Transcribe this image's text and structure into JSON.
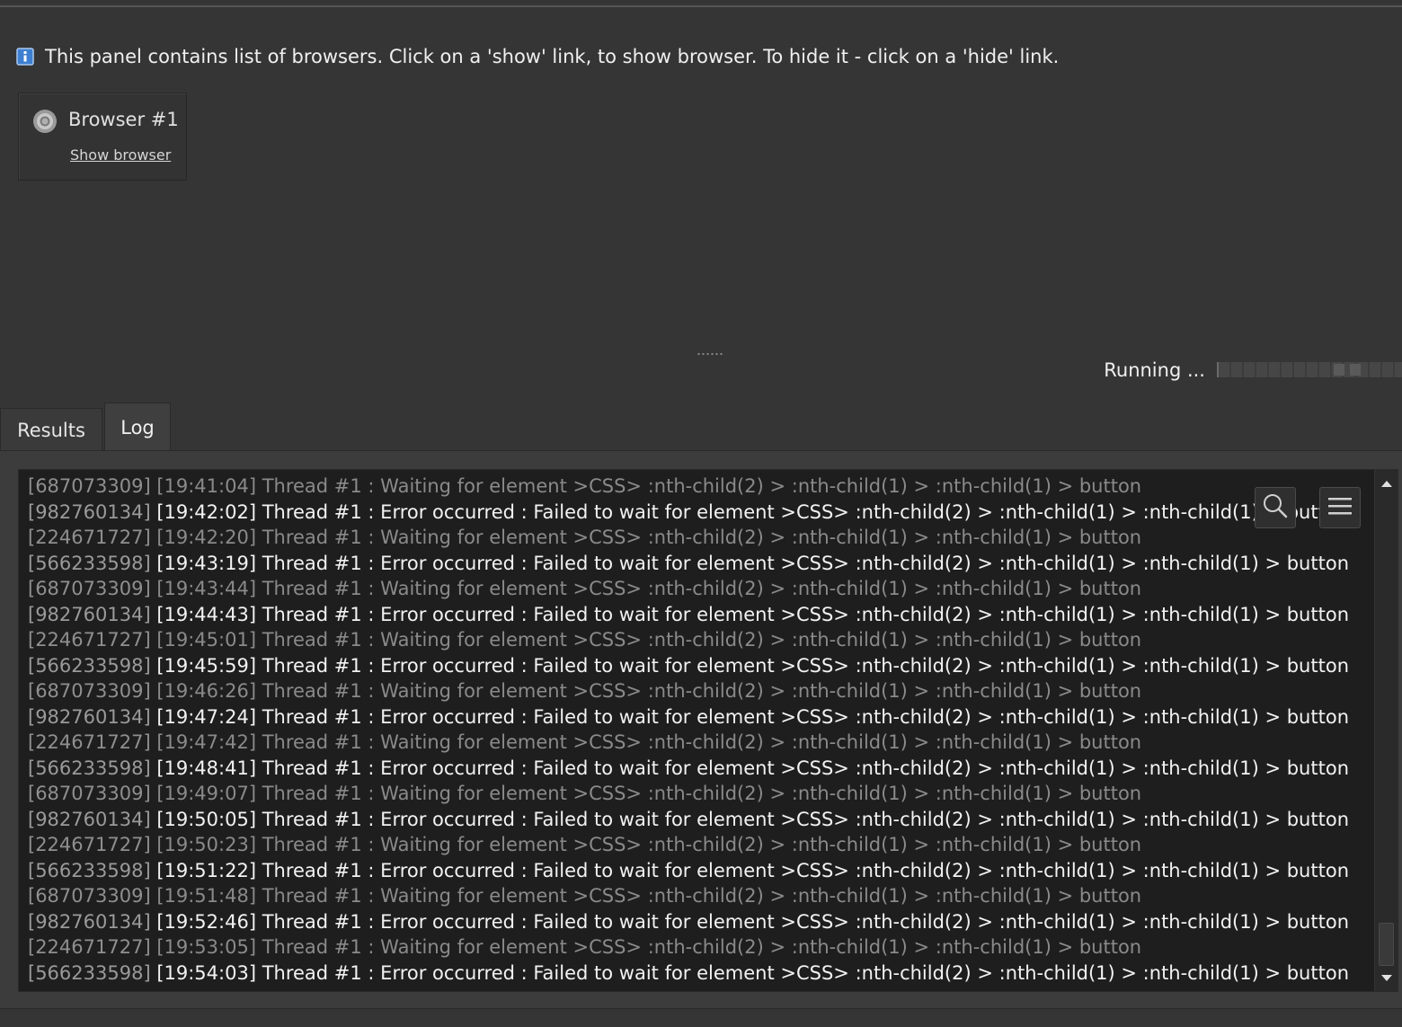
{
  "info": {
    "message": "This panel contains list of browsers. Click on a 'show' link, to show browser. To hide it - click on a 'hide' link.",
    "icon": "info-icon"
  },
  "browser_card": {
    "title": "Browser #1",
    "link": "Show browser",
    "icon": "browser-icon"
  },
  "status": {
    "text": "Running ..."
  },
  "tabs": [
    {
      "label": "Results",
      "active": false
    },
    {
      "label": "Log",
      "active": true
    }
  ],
  "log": {
    "lines": [
      {
        "id": "[687073309]",
        "text": " [19:41:04] Thread #1 : Waiting for element >CSS> :nth-child(2) > :nth-child(1) > :nth-child(1) > button",
        "kind": "waiting"
      },
      {
        "id": "[982760134]",
        "text": " [19:42:02] Thread #1 : Error occurred : Failed to wait for element >CSS> :nth-child(2) > :nth-child(1) > :nth-child(1) > button",
        "kind": "error"
      },
      {
        "id": "[224671727]",
        "text": " [19:42:20] Thread #1 : Waiting for element >CSS> :nth-child(2) > :nth-child(1) > :nth-child(1) > button",
        "kind": "waiting"
      },
      {
        "id": "[566233598]",
        "text": " [19:43:19] Thread #1 : Error occurred : Failed to wait for element >CSS> :nth-child(2) > :nth-child(1) > :nth-child(1) > button",
        "kind": "error"
      },
      {
        "id": "[687073309]",
        "text": " [19:43:44] Thread #1 : Waiting for element >CSS> :nth-child(2) > :nth-child(1) > :nth-child(1) > button",
        "kind": "waiting"
      },
      {
        "id": "[982760134]",
        "text": " [19:44:43] Thread #1 : Error occurred : Failed to wait for element >CSS> :nth-child(2) > :nth-child(1) > :nth-child(1) > button",
        "kind": "error"
      },
      {
        "id": "[224671727]",
        "text": " [19:45:01] Thread #1 : Waiting for element >CSS> :nth-child(2) > :nth-child(1) > :nth-child(1) > button",
        "kind": "waiting"
      },
      {
        "id": "[566233598]",
        "text": " [19:45:59] Thread #1 : Error occurred : Failed to wait for element >CSS> :nth-child(2) > :nth-child(1) > :nth-child(1) > button",
        "kind": "error"
      },
      {
        "id": "[687073309]",
        "text": " [19:46:26] Thread #1 : Waiting for element >CSS> :nth-child(2) > :nth-child(1) > :nth-child(1) > button",
        "kind": "waiting"
      },
      {
        "id": "[982760134]",
        "text": " [19:47:24] Thread #1 : Error occurred : Failed to wait for element >CSS> :nth-child(2) > :nth-child(1) > :nth-child(1) > button",
        "kind": "error"
      },
      {
        "id": "[224671727]",
        "text": " [19:47:42] Thread #1 : Waiting for element >CSS> :nth-child(2) > :nth-child(1) > :nth-child(1) > button",
        "kind": "waiting"
      },
      {
        "id": "[566233598]",
        "text": " [19:48:41] Thread #1 : Error occurred : Failed to wait for element >CSS> :nth-child(2) > :nth-child(1) > :nth-child(1) > button",
        "kind": "error"
      },
      {
        "id": "[687073309]",
        "text": " [19:49:07] Thread #1 : Waiting for element >CSS> :nth-child(2) > :nth-child(1) > :nth-child(1) > button",
        "kind": "waiting"
      },
      {
        "id": "[982760134]",
        "text": " [19:50:05] Thread #1 : Error occurred : Failed to wait for element >CSS> :nth-child(2) > :nth-child(1) > :nth-child(1) > button",
        "kind": "error"
      },
      {
        "id": "[224671727]",
        "text": " [19:50:23] Thread #1 : Waiting for element >CSS> :nth-child(2) > :nth-child(1) > :nth-child(1) > button",
        "kind": "waiting"
      },
      {
        "id": "[566233598]",
        "text": " [19:51:22] Thread #1 : Error occurred : Failed to wait for element >CSS> :nth-child(2) > :nth-child(1) > :nth-child(1) > button",
        "kind": "error"
      },
      {
        "id": "[687073309]",
        "text": " [19:51:48] Thread #1 : Waiting for element >CSS> :nth-child(2) > :nth-child(1) > :nth-child(1) > button",
        "kind": "waiting"
      },
      {
        "id": "[982760134]",
        "text": " [19:52:46] Thread #1 : Error occurred : Failed to wait for element >CSS> :nth-child(2) > :nth-child(1) > :nth-child(1) > button",
        "kind": "error"
      },
      {
        "id": "[224671727]",
        "text": " [19:53:05] Thread #1 : Waiting for element >CSS> :nth-child(2) > :nth-child(1) > :nth-child(1) > button",
        "kind": "waiting"
      },
      {
        "id": "[566233598]",
        "text": " [19:54:03] Thread #1 : Error occurred : Failed to wait for element >CSS> :nth-child(2) > :nth-child(1) > :nth-child(1) > button",
        "kind": "error"
      }
    ]
  },
  "toolbar": {
    "search_icon": "search-icon",
    "menu_icon": "menu-icon"
  },
  "colors": {
    "background": "#353535",
    "log_background": "#1e1e1e",
    "error_text": "#f2f2f2",
    "waiting_text": "#8a8a8a"
  }
}
